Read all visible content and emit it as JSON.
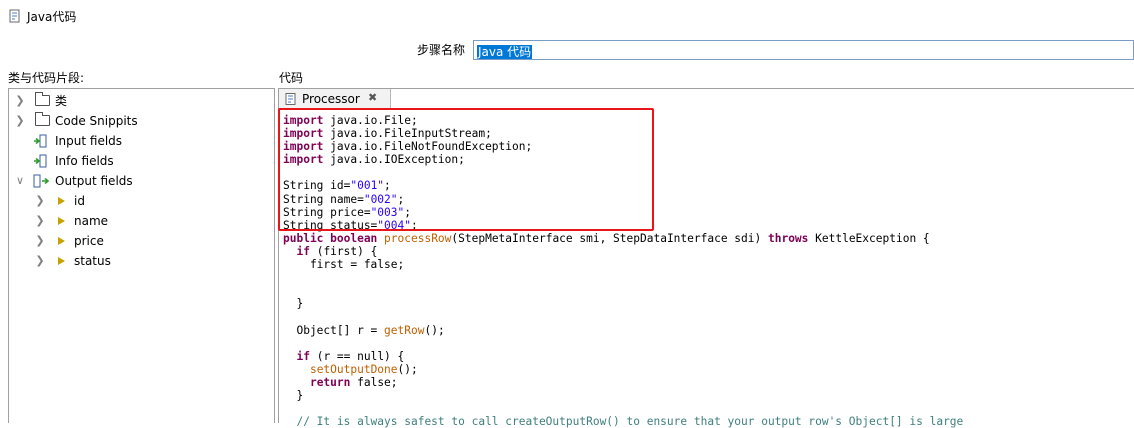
{
  "window": {
    "title": "Java代码",
    "icon": "java-class-icon"
  },
  "step": {
    "label": "步骤名称",
    "value": "Java 代码"
  },
  "left_panel": {
    "label": "类与代码片段:",
    "tree": [
      {
        "label": "类",
        "icon": "folder-icon",
        "twisty": "collapsed"
      },
      {
        "label": "Code Snippits",
        "icon": "folder-icon",
        "twisty": "collapsed"
      },
      {
        "label": "Input fields",
        "icon": "input-fields-icon",
        "twisty": "none"
      },
      {
        "label": "Info fields",
        "icon": "info-fields-icon",
        "twisty": "none"
      },
      {
        "label": "Output fields",
        "icon": "output-fields-icon",
        "twisty": "expanded"
      },
      {
        "label": "id",
        "icon": "field-triangle-icon",
        "twisty": "collapsed"
      },
      {
        "label": "name",
        "icon": "field-triangle-icon",
        "twisty": "collapsed"
      },
      {
        "label": "price",
        "icon": "field-triangle-icon",
        "twisty": "collapsed"
      },
      {
        "label": "status",
        "icon": "field-triangle-icon",
        "twisty": "collapsed"
      }
    ]
  },
  "editor": {
    "label": "代码",
    "tab": {
      "label": "Processor",
      "close_icon": "close-icon"
    },
    "code_lines": [
      [
        {
          "t": "import",
          "c": "kw"
        },
        {
          "t": " java.io.File;"
        }
      ],
      [
        {
          "t": "import",
          "c": "kw"
        },
        {
          "t": " java.io.FileInputStream;"
        }
      ],
      [
        {
          "t": "import",
          "c": "kw"
        },
        {
          "t": " java.io.FileNotFoundException;"
        }
      ],
      [
        {
          "t": "import",
          "c": "kw"
        },
        {
          "t": " java.io.IOException;"
        }
      ],
      [],
      [
        {
          "t": "String id="
        },
        {
          "t": "\"001\"",
          "c": "str"
        },
        {
          "t": ";"
        }
      ],
      [
        {
          "t": "String name="
        },
        {
          "t": "\"002\"",
          "c": "str"
        },
        {
          "t": ";"
        }
      ],
      [
        {
          "t": "String price="
        },
        {
          "t": "\"003\"",
          "c": "str"
        },
        {
          "t": ";"
        }
      ],
      [
        {
          "t": "String status="
        },
        {
          "t": "\"004\"",
          "c": "str"
        },
        {
          "t": ";"
        }
      ],
      [
        {
          "t": "public boolean",
          "c": "kw"
        },
        {
          "t": " "
        },
        {
          "t": "processRow",
          "c": "fn"
        },
        {
          "t": "(StepMetaInterface smi, StepDataInterface sdi) "
        },
        {
          "t": "throws",
          "c": "kw"
        },
        {
          "t": " KettleException {"
        }
      ],
      [
        {
          "t": "  "
        },
        {
          "t": "if",
          "c": "kw"
        },
        {
          "t": " (first) {"
        }
      ],
      [
        {
          "t": "    first = false;"
        }
      ],
      [],
      [],
      [
        {
          "t": "  }"
        }
      ],
      [],
      [
        {
          "t": "  Object[] r = "
        },
        {
          "t": "getRow",
          "c": "fn"
        },
        {
          "t": "();"
        }
      ],
      [],
      [
        {
          "t": "  "
        },
        {
          "t": "if",
          "c": "kw"
        },
        {
          "t": " (r == null) {"
        }
      ],
      [
        {
          "t": "    "
        },
        {
          "t": "setOutputDone",
          "c": "fn"
        },
        {
          "t": "();"
        }
      ],
      [
        {
          "t": "    "
        },
        {
          "t": "return",
          "c": "kw"
        },
        {
          "t": " false;"
        }
      ],
      [
        {
          "t": "  }"
        }
      ],
      [],
      [
        {
          "t": "  // It is always safest to call createOutputRow() to ensure that your output row's Object[] is large",
          "c": "cm"
        }
      ]
    ]
  },
  "colors": {
    "highlight": "#e8161b",
    "keyword": "#7f0055",
    "string": "#2a00ff",
    "method": "#c06000",
    "comment": "#3f7f7f",
    "selection": "#0078d7"
  }
}
